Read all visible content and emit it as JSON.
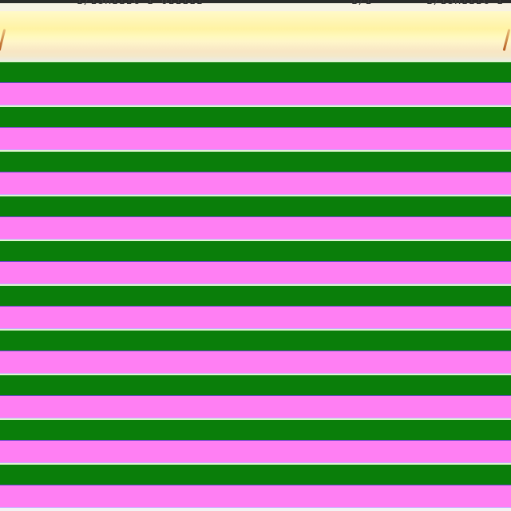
{
  "titlebar": {
    "left_text": "I/ISHIIIC I UIIIII",
    "mid_text": "I/I",
    "right_text": "I/ISHIIIC I OI"
  },
  "colors": {
    "green": "#0a7e0a",
    "pink": "#ff7ff3",
    "header_yellow": "#fff3a4",
    "handle_orange": "#b45a1e"
  },
  "stripes": [
    "green",
    "pink",
    "green",
    "pink",
    "green",
    "pink",
    "green",
    "pink",
    "green",
    "pink",
    "green",
    "pink",
    "green",
    "pink",
    "green",
    "pink",
    "green",
    "pink",
    "green",
    "pink"
  ]
}
